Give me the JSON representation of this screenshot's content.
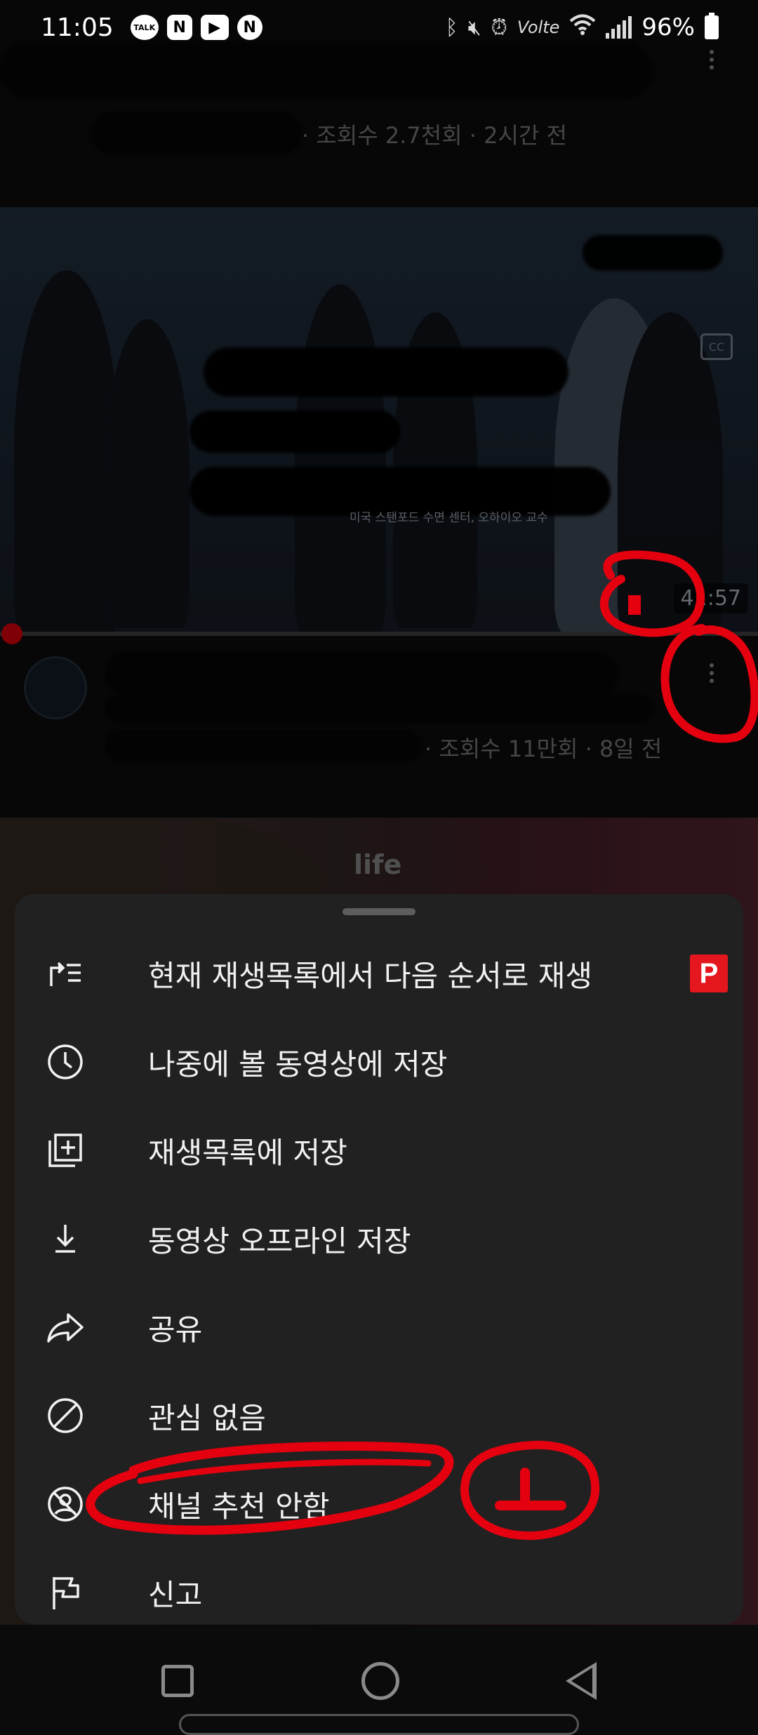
{
  "status_bar": {
    "time": "11:05",
    "notification_icons": [
      "TALK",
      "N",
      "▶",
      "N"
    ],
    "volte": "Volte",
    "battery": "96%"
  },
  "feed": {
    "video1": {
      "meta": "· 조회수 2.7천회 · 2시간 전"
    },
    "video2": {
      "thumbnail_caption": "미국 스탠포드 수면 센터, 오하이오 교수",
      "duration": "41:57",
      "meta": "· 조회수 11만회 · 8일 전"
    },
    "video3": {
      "thumbnail_text": "life"
    }
  },
  "sheet": {
    "items": [
      {
        "label": "현재 재생목록에서 다음 순서로 재생",
        "icon": "play-next-icon",
        "badge": "P"
      },
      {
        "label": "나중에 볼 동영상에 저장",
        "icon": "clock-icon"
      },
      {
        "label": "재생목록에 저장",
        "icon": "playlist-add-icon"
      },
      {
        "label": "동영상 오프라인 저장",
        "icon": "download-icon"
      },
      {
        "label": "공유",
        "icon": "share-icon"
      },
      {
        "label": "관심 없음",
        "icon": "block-icon"
      },
      {
        "label": "채널 추천 안함",
        "icon": "no-channel-icon"
      },
      {
        "label": "신고",
        "icon": "flag-icon"
      }
    ]
  },
  "colors": {
    "sheet_bg": "#212121",
    "badge_red": "#e4161e",
    "annotation_red": "#e4000f",
    "progress_red": "#c4000b"
  }
}
